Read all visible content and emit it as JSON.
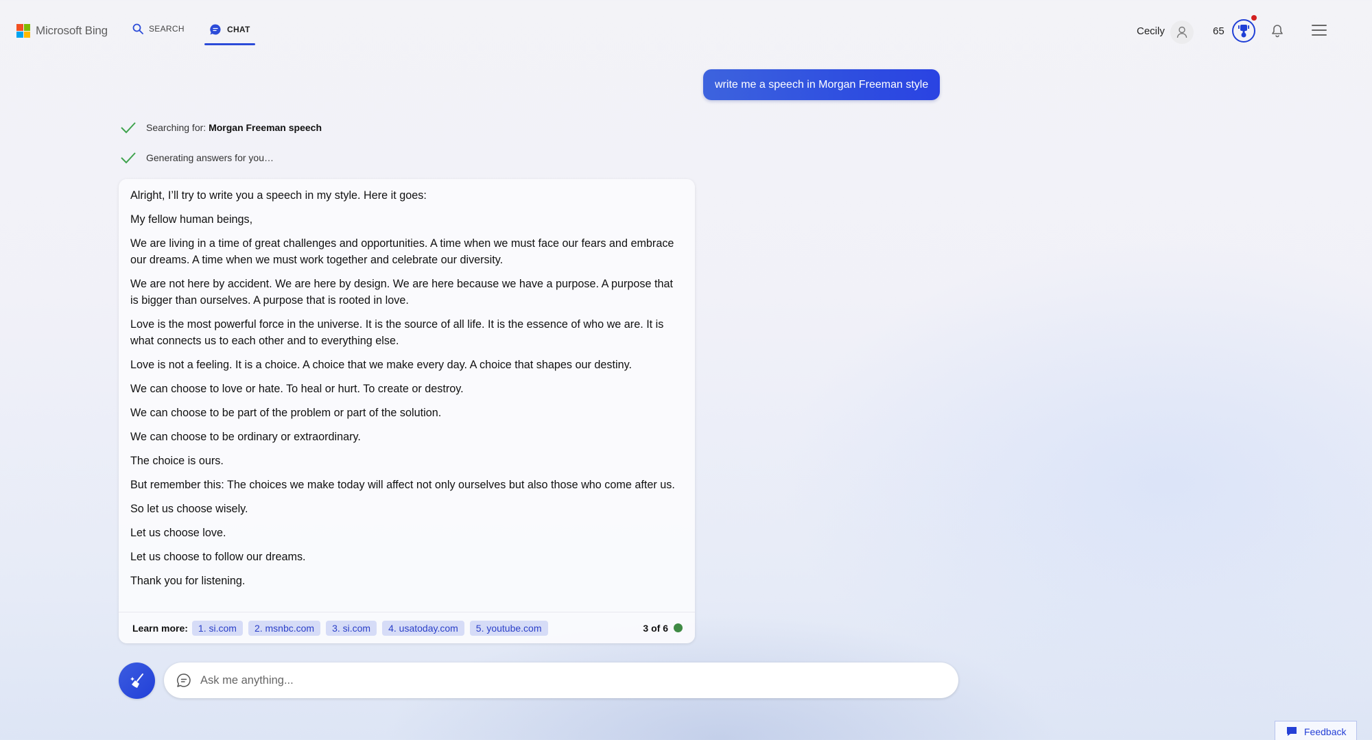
{
  "header": {
    "brand": "Microsoft Bing",
    "brand_colors": [
      "#f25022",
      "#7fba00",
      "#00a4ef",
      "#ffb900"
    ],
    "nav": [
      {
        "label": "SEARCH",
        "icon": "search-icon",
        "active": false
      },
      {
        "label": "CHAT",
        "icon": "chat-bubble-icon",
        "active": true
      }
    ],
    "user_name": "Cecily",
    "rewards_points": "65",
    "accent_color": "#2b4bd8"
  },
  "conversation": {
    "user_message": "write me a speech in Morgan Freeman style",
    "status": [
      {
        "prefix": "Searching for: ",
        "bold": "Morgan Freeman speech"
      },
      {
        "prefix": "Generating answers for you…",
        "bold": ""
      }
    ],
    "answer_paragraphs": [
      "Alright, I’ll try to write you a speech in my style. Here it goes:",
      "My fellow human beings,",
      "We are living in a time of great challenges and opportunities. A time when we must face our fears and embrace our dreams. A time when we must work together and celebrate our diversity.",
      "We are not here by accident. We are here by design. We are here because we have a purpose. A purpose that is bigger than ourselves. A purpose that is rooted in love.",
      "Love is the most powerful force in the universe. It is the source of all life. It is the essence of who we are. It is what connects us to each other and to everything else.",
      "Love is not a feeling. It is a choice. A choice that we make every day. A choice that shapes our destiny.",
      "We can choose to love or hate. To heal or hurt. To create or destroy.",
      "We can choose to be part of the problem or part of the solution.",
      "We can choose to be ordinary or extraordinary.",
      "The choice is ours.",
      "But remember this: The choices we make today will affect not only ourselves but also those who come after us.",
      "So let us choose wisely.",
      "Let us choose love.",
      "Let us choose to follow our dreams.",
      "Thank you for listening."
    ],
    "learn_more_label": "Learn more:",
    "sources": [
      "1. si.com",
      "2. msnbc.com",
      "3. si.com",
      "4. usatoday.com",
      "5. youtube.com"
    ],
    "turn_counter": "3 of 6",
    "turn_indicator_color": "#3f8a44"
  },
  "input": {
    "placeholder": "Ask me anything...",
    "value": ""
  },
  "feedback_label": "Feedback"
}
